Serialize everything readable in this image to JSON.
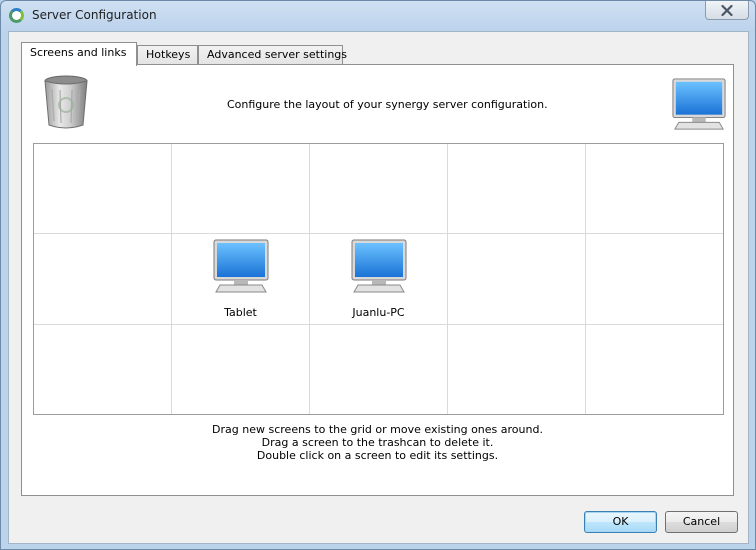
{
  "window": {
    "title": "Server Configuration",
    "app_icon": "synergy-icon",
    "close_icon": "close-icon"
  },
  "tabs": [
    {
      "label": "Screens and links",
      "active": true
    },
    {
      "label": "Hotkeys",
      "active": false
    },
    {
      "label": "Advanced server settings",
      "active": false
    }
  ],
  "screens_tab": {
    "header_text": "Configure the layout of your synergy server configuration.",
    "trash_icon": "trashcan-icon",
    "new_screen_icon": "monitor-icon",
    "grid": {
      "rows": 3,
      "columns": 5,
      "screens": [
        {
          "name": "Tablet",
          "row": 1,
          "col": 1,
          "icon": "monitor-icon"
        },
        {
          "name": "Juanlu-PC",
          "row": 1,
          "col": 2,
          "icon": "monitor-icon"
        }
      ]
    },
    "hints": [
      "Drag new screens to the grid or move existing ones around.",
      "Drag a screen to the trashcan to delete it.",
      "Double click on a screen to edit its settings."
    ]
  },
  "buttons": {
    "ok_label": "OK",
    "cancel_label": "Cancel"
  },
  "colors": {
    "selection_accent": "#3c7fb1",
    "monitor_screen": "#2a8ae0"
  }
}
